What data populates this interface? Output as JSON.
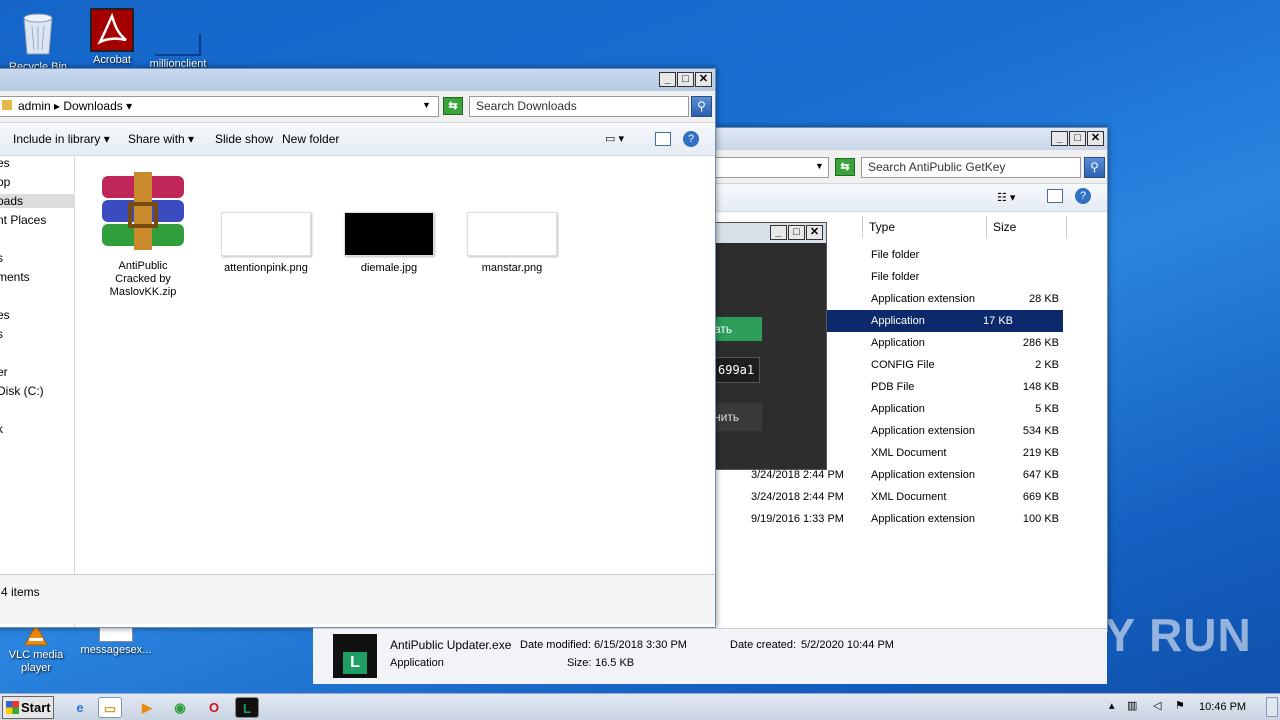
{
  "desktop": {
    "icons": [
      {
        "label": "Recycle Bin"
      },
      {
        "label": "Acrobat"
      },
      {
        "label": "millionclient"
      },
      {
        "label": "VLC media player"
      },
      {
        "label": "messagesex..."
      }
    ]
  },
  "front_explorer": {
    "breadcrumb": {
      "user": "admin",
      "folder": "Downloads"
    },
    "search_placeholder": "Search Downloads",
    "toolbar": {
      "include_in_library": "Include in library",
      "share_with": "Share with",
      "slide_show": "Slide show",
      "new_folder": "New folder"
    },
    "nav": [
      "es",
      "op",
      "oads",
      "nt Places",
      "s",
      "ments",
      "es",
      "s",
      "er",
      "Disk (C:)",
      "k"
    ],
    "files": [
      {
        "name": "AntiPublic Cracked by MaslovKK.zip"
      },
      {
        "name": "attentionpink.png"
      },
      {
        "name": "diemale.jpg"
      },
      {
        "name": "manstar.png"
      }
    ],
    "status": "4 items"
  },
  "back_explorer": {
    "search_placeholder": "Search AntiPublic GetKey",
    "columns": {
      "type": "Type",
      "size": "Size"
    },
    "rows": [
      {
        "date": "M",
        "type": "File folder",
        "size": ""
      },
      {
        "date": "M",
        "type": "File folder",
        "size": ""
      },
      {
        "date": "2 PM",
        "type": "Application extension",
        "size": "28 KB"
      },
      {
        "date": "PM",
        "type": "Application",
        "size": "17 KB"
      },
      {
        "date": "PM",
        "type": "Application",
        "size": "286 KB"
      },
      {
        "date": "PM",
        "type": "CONFIG File",
        "size": "2 KB"
      },
      {
        "date": "47 PM",
        "type": "PDB File",
        "size": "148 KB"
      },
      {
        "date": "PM",
        "type": "Application",
        "size": "5 KB"
      },
      {
        "date": "M",
        "type": "Application extension",
        "size": "534 KB"
      },
      {
        "date": "M",
        "type": "XML Document",
        "size": "219 KB"
      },
      {
        "date": "3/24/2018 2:44 PM",
        "type": "Application extension",
        "size": "647 KB"
      },
      {
        "date": "3/24/2018 2:44 PM",
        "type": "XML Document",
        "size": "669 KB"
      },
      {
        "date": "9/19/2016 1:33 PM",
        "type": "Application extension",
        "size": "100 KB"
      }
    ],
    "selected_row": 3
  },
  "dark_app": {
    "green_button": "ать",
    "key_field": "699a1",
    "dark_button": "нить"
  },
  "details_pane": {
    "name": "AntiPublic Updater.exe",
    "date_modified_label": "Date modified:",
    "date_modified": "6/15/2018 3:30 PM",
    "date_created_label": "Date created:",
    "date_created": "5/2/2020 10:44 PM",
    "type": "Application",
    "size_label": "Size:",
    "size": "16.5 KB"
  },
  "taskbar": {
    "start": "Start",
    "clock": "10:46 PM"
  },
  "watermark": "ANY RUN",
  "colors": {
    "selection": "#0c2a6b",
    "green_button": "#2e9e5b",
    "desktop": "#1a6fd1"
  }
}
